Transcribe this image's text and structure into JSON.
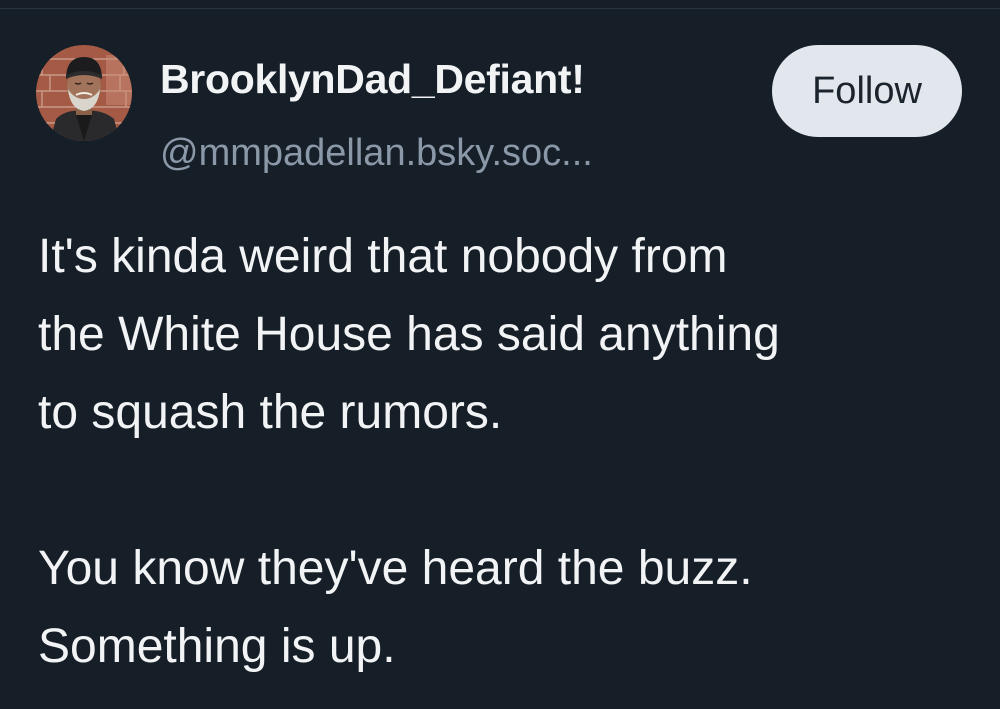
{
  "author": {
    "display_name": "BrooklynDad_Defiant!",
    "handle": "@mmpadellan.bsky.soc...",
    "avatar_icon": "user-avatar-photo"
  },
  "actions": {
    "follow_label": "Follow"
  },
  "post": {
    "paragraph1": [
      "It's kinda weird that nobody from",
      "the White House has said anything",
      "to squash the rumors."
    ],
    "paragraph2": [
      "You know they've heard the buzz.",
      "Something is up."
    ]
  },
  "colors": {
    "background": "#161e27",
    "text": "#f1f3f5",
    "handle": "#8a98a8",
    "follow_bg": "#e2e7ee"
  }
}
